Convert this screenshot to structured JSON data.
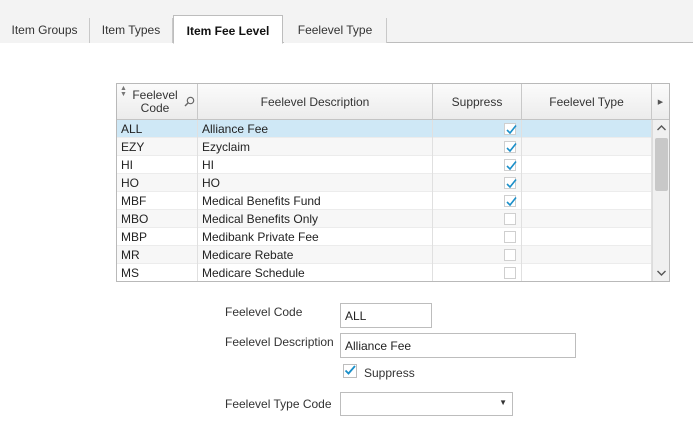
{
  "tabs": [
    {
      "label": "Item Groups"
    },
    {
      "label": "Item Types"
    },
    {
      "label": "Item Fee Level"
    },
    {
      "label": "Feelevel Type"
    }
  ],
  "grid": {
    "columns": {
      "code": "Feelevel Code",
      "description": "Feelevel Description",
      "suppress": "Suppress",
      "type": "Feelevel Type"
    },
    "rows": [
      {
        "code": "ALL",
        "description": "Alliance Fee",
        "suppress": true
      },
      {
        "code": "EZY",
        "description": "Ezyclaim",
        "suppress": true
      },
      {
        "code": "HI",
        "description": "HI",
        "suppress": true
      },
      {
        "code": "HO",
        "description": "HO",
        "suppress": true
      },
      {
        "code": "MBF",
        "description": "Medical Benefits Fund",
        "suppress": true
      },
      {
        "code": "MBO",
        "description": "Medical Benefits Only",
        "suppress": false
      },
      {
        "code": "MBP",
        "description": "Medibank Private Fee",
        "suppress": false
      },
      {
        "code": "MR",
        "description": "Medicare Rebate",
        "suppress": false
      },
      {
        "code": "MS",
        "description": "Medicare Schedule",
        "suppress": false
      }
    ],
    "selected_index": 0
  },
  "form": {
    "code_label": "Feelevel Code",
    "code_value": "ALL",
    "description_label": "Feelevel Description",
    "description_value": "Alliance Fee",
    "suppress_label": "Suppress",
    "suppress_checked": true,
    "type_code_label": "Feelevel Type Code",
    "type_code_value": ""
  },
  "colors": {
    "accent": "#1a8fc9",
    "selected_row": "#cfe8f6"
  }
}
